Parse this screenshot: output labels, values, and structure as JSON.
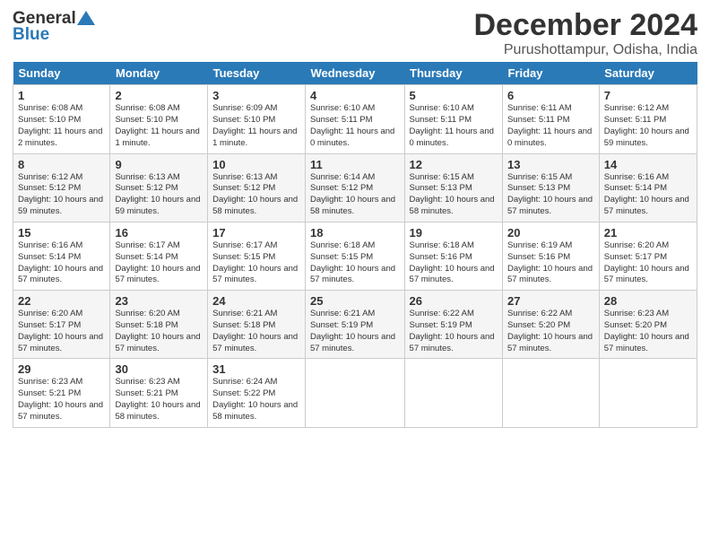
{
  "header": {
    "logo_general": "General",
    "logo_blue": "Blue",
    "title": "December 2024",
    "location": "Purushottampur, Odisha, India"
  },
  "calendar": {
    "days_of_week": [
      "Sunday",
      "Monday",
      "Tuesday",
      "Wednesday",
      "Thursday",
      "Friday",
      "Saturday"
    ],
    "weeks": [
      [
        {
          "day": "1",
          "sunrise": "6:08 AM",
          "sunset": "5:10 PM",
          "daylight": "11 hours and 2 minutes."
        },
        {
          "day": "2",
          "sunrise": "6:08 AM",
          "sunset": "5:10 PM",
          "daylight": "11 hours and 1 minute."
        },
        {
          "day": "3",
          "sunrise": "6:09 AM",
          "sunset": "5:10 PM",
          "daylight": "11 hours and 1 minute."
        },
        {
          "day": "4",
          "sunrise": "6:10 AM",
          "sunset": "5:11 PM",
          "daylight": "11 hours and 0 minutes."
        },
        {
          "day": "5",
          "sunrise": "6:10 AM",
          "sunset": "5:11 PM",
          "daylight": "11 hours and 0 minutes."
        },
        {
          "day": "6",
          "sunrise": "6:11 AM",
          "sunset": "5:11 PM",
          "daylight": "11 hours and 0 minutes."
        },
        {
          "day": "7",
          "sunrise": "6:12 AM",
          "sunset": "5:11 PM",
          "daylight": "10 hours and 59 minutes."
        }
      ],
      [
        {
          "day": "8",
          "sunrise": "6:12 AM",
          "sunset": "5:12 PM",
          "daylight": "10 hours and 59 minutes."
        },
        {
          "day": "9",
          "sunrise": "6:13 AM",
          "sunset": "5:12 PM",
          "daylight": "10 hours and 59 minutes."
        },
        {
          "day": "10",
          "sunrise": "6:13 AM",
          "sunset": "5:12 PM",
          "daylight": "10 hours and 58 minutes."
        },
        {
          "day": "11",
          "sunrise": "6:14 AM",
          "sunset": "5:12 PM",
          "daylight": "10 hours and 58 minutes."
        },
        {
          "day": "12",
          "sunrise": "6:15 AM",
          "sunset": "5:13 PM",
          "daylight": "10 hours and 58 minutes."
        },
        {
          "day": "13",
          "sunrise": "6:15 AM",
          "sunset": "5:13 PM",
          "daylight": "10 hours and 57 minutes."
        },
        {
          "day": "14",
          "sunrise": "6:16 AM",
          "sunset": "5:14 PM",
          "daylight": "10 hours and 57 minutes."
        }
      ],
      [
        {
          "day": "15",
          "sunrise": "6:16 AM",
          "sunset": "5:14 PM",
          "daylight": "10 hours and 57 minutes."
        },
        {
          "day": "16",
          "sunrise": "6:17 AM",
          "sunset": "5:14 PM",
          "daylight": "10 hours and 57 minutes."
        },
        {
          "day": "17",
          "sunrise": "6:17 AM",
          "sunset": "5:15 PM",
          "daylight": "10 hours and 57 minutes."
        },
        {
          "day": "18",
          "sunrise": "6:18 AM",
          "sunset": "5:15 PM",
          "daylight": "10 hours and 57 minutes."
        },
        {
          "day": "19",
          "sunrise": "6:18 AM",
          "sunset": "5:16 PM",
          "daylight": "10 hours and 57 minutes."
        },
        {
          "day": "20",
          "sunrise": "6:19 AM",
          "sunset": "5:16 PM",
          "daylight": "10 hours and 57 minutes."
        },
        {
          "day": "21",
          "sunrise": "6:20 AM",
          "sunset": "5:17 PM",
          "daylight": "10 hours and 57 minutes."
        }
      ],
      [
        {
          "day": "22",
          "sunrise": "6:20 AM",
          "sunset": "5:17 PM",
          "daylight": "10 hours and 57 minutes."
        },
        {
          "day": "23",
          "sunrise": "6:20 AM",
          "sunset": "5:18 PM",
          "daylight": "10 hours and 57 minutes."
        },
        {
          "day": "24",
          "sunrise": "6:21 AM",
          "sunset": "5:18 PM",
          "daylight": "10 hours and 57 minutes."
        },
        {
          "day": "25",
          "sunrise": "6:21 AM",
          "sunset": "5:19 PM",
          "daylight": "10 hours and 57 minutes."
        },
        {
          "day": "26",
          "sunrise": "6:22 AM",
          "sunset": "5:19 PM",
          "daylight": "10 hours and 57 minutes."
        },
        {
          "day": "27",
          "sunrise": "6:22 AM",
          "sunset": "5:20 PM",
          "daylight": "10 hours and 57 minutes."
        },
        {
          "day": "28",
          "sunrise": "6:23 AM",
          "sunset": "5:20 PM",
          "daylight": "10 hours and 57 minutes."
        }
      ],
      [
        {
          "day": "29",
          "sunrise": "6:23 AM",
          "sunset": "5:21 PM",
          "daylight": "10 hours and 57 minutes."
        },
        {
          "day": "30",
          "sunrise": "6:23 AM",
          "sunset": "5:21 PM",
          "daylight": "10 hours and 58 minutes."
        },
        {
          "day": "31",
          "sunrise": "6:24 AM",
          "sunset": "5:22 PM",
          "daylight": "10 hours and 58 minutes."
        },
        null,
        null,
        null,
        null
      ]
    ]
  },
  "labels": {
    "sunrise_prefix": "Sunrise: ",
    "sunset_prefix": "Sunset: ",
    "daylight_prefix": "Daylight: "
  }
}
